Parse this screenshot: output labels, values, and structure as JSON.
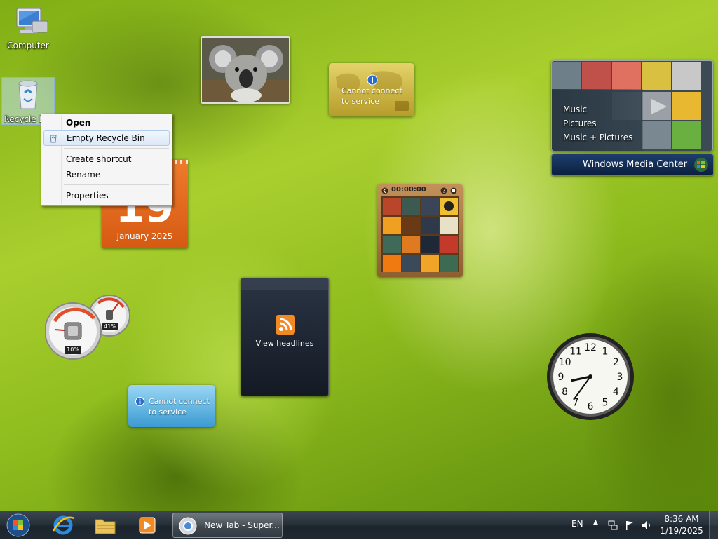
{
  "desktop": {
    "icons": [
      {
        "label": "Computer"
      },
      {
        "label": "Recycle Bin"
      }
    ]
  },
  "context_menu": {
    "items": [
      {
        "label": "Open",
        "default": true
      },
      {
        "label": "Empty Recycle Bin",
        "highlighted": true
      },
      {
        "label": "Create shortcut"
      },
      {
        "label": "Rename"
      },
      {
        "label": "Properties"
      }
    ]
  },
  "gadgets": {
    "weather_top": {
      "message": "Cannot connect to service",
      "line1": "Cannot connect",
      "line2": "to service"
    },
    "weather_bottom": {
      "line1": "Cannot connect",
      "line2": "to service"
    },
    "calendar": {
      "day": "19",
      "month_year": "January 2025"
    },
    "media_center": {
      "items": [
        "Music",
        "Pictures",
        "Music + Pictures"
      ],
      "bar_label": "Windows Media Center"
    },
    "puzzle": {
      "timer": "00:00:00"
    },
    "feed": {
      "label": "View headlines"
    },
    "cpu_meter": {
      "cpu_percent": "10%",
      "memory_percent": "41%"
    },
    "clock": {
      "numbers": [
        "12",
        "1",
        "2",
        "3",
        "4",
        "5",
        "6",
        "7",
        "8",
        "9",
        "10",
        "11"
      ],
      "hour": 8,
      "minute": 36
    }
  },
  "taskbar": {
    "running_task": "New Tab - Super...",
    "language": "EN",
    "time": "8:36 AM",
    "date": "1/19/2025"
  },
  "colors": {
    "taskbar": "#27313a",
    "calendar": "#e06a1e",
    "menu_highlight": "#dbe8f7"
  }
}
